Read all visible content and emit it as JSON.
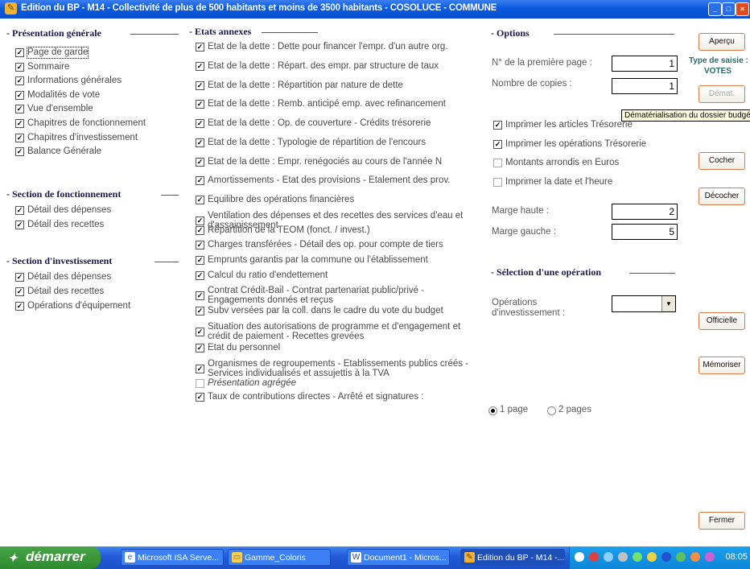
{
  "window": {
    "title": "Edition du BP - M14 - Collectivité de plus de 500 habitants et moins de 3500 habitants - COSOLUCE - COMMUNE"
  },
  "presentation": {
    "heading": "- Présentation générale",
    "items": [
      {
        "label": "Page de garde",
        "checked": true
      },
      {
        "label": "Sommaire",
        "checked": true
      },
      {
        "label": "Informations générales",
        "checked": true
      },
      {
        "label": "Modalités de vote",
        "checked": true
      },
      {
        "label": "Vue d'ensemble",
        "checked": true
      },
      {
        "label": "Chapitres de fonctionnement",
        "checked": true
      },
      {
        "label": "Chapitres d'investissement",
        "checked": true
      },
      {
        "label": "Balance Générale",
        "checked": true
      }
    ]
  },
  "fonctionnement": {
    "heading": "- Section de fonctionnement",
    "items": [
      {
        "label": "Détail des dépenses",
        "checked": true
      },
      {
        "label": "Détail des recettes",
        "checked": true
      }
    ]
  },
  "investissement": {
    "heading": "- Section d'investissement",
    "items": [
      {
        "label": "Détail des dépenses",
        "checked": true
      },
      {
        "label": "Détail des recettes",
        "checked": true
      },
      {
        "label": "Opérations d'équipement",
        "checked": true
      }
    ]
  },
  "annexes": {
    "heading": "- Etats annexes",
    "items": [
      {
        "label": "Etat de la dette : Dette pour financer l'empr. d'un autre org.",
        "checked": true
      },
      {
        "label": "Etat de la dette : Répart. des empr. par structure de taux",
        "checked": true
      },
      {
        "label": "Etat de la dette : Répartition par nature de dette",
        "checked": true
      },
      {
        "label": "Etat de la dette : Remb. anticipé emp. avec refinancement",
        "checked": true
      },
      {
        "label": "Etat de la dette : Op. de couverture - Crédits trésorerie",
        "checked": true
      },
      {
        "label": "Etat de la dette : Typologie de répartition de l'encours",
        "checked": true
      },
      {
        "label": "Etat de la dette : Empr. renégociés au cours de l'année N",
        "checked": true
      },
      {
        "label": "Amortissements - Etat des provisions - Etalement des prov.",
        "checked": true
      },
      {
        "label": "Equilibre des opérations financières",
        "checked": true
      },
      {
        "label": "Ventilation des dépenses et des recettes des services d'eau et d'assainissement",
        "checked": true
      },
      {
        "label": "Répartition de la TEOM (fonct. / invest.)",
        "checked": true
      },
      {
        "label": "Charges transférées - Détail des op. pour compte de tiers",
        "checked": true
      },
      {
        "label": "Emprunts garantis par la commune ou l'établissement",
        "checked": true
      },
      {
        "label": "Calcul du ratio d'endettement",
        "checked": true
      },
      {
        "label": "Contrat Crédit-Bail - Contrat partenariat public/privé - Engagements donnés et reçus",
        "checked": true
      },
      {
        "label": "Subv versées par la coll. dans le cadre du vote du budget",
        "checked": true
      },
      {
        "label": "Situation des autorisations de programme et d'engagement et crédit de paiement - Recettes grevées",
        "checked": true
      },
      {
        "label": "Etat du personnel",
        "checked": true
      },
      {
        "label": "Organismes de regroupements - Etablissements publics créés - Services individualisés et assujettis à la TVA",
        "checked": true
      },
      {
        "label": "Présentation agrégée",
        "checked": false
      },
      {
        "label": "Taux de contributions directes - Arrêté et signatures :",
        "checked": true
      }
    ]
  },
  "options": {
    "heading": "- Options",
    "first_page_label": "N° de la première page :",
    "first_page_value": "1",
    "copies_label": "Nombre de copies :",
    "copies_value": "1",
    "checks": [
      {
        "label": "Imprimer les articles Trésorerie",
        "checked": true
      },
      {
        "label": "Imprimer les opérations Trésorerie",
        "checked": true
      },
      {
        "label": "Montants arrondis en Euros",
        "checked": false
      },
      {
        "label": "Imprimer la date et l'heure",
        "checked": false
      }
    ],
    "marge_haute_label": "Marge haute :",
    "marge_haute_value": "2",
    "marge_gauche_label": "Marge gauche :",
    "marge_gauche_value": "5"
  },
  "selection": {
    "heading": "- Sélection d'une opération",
    "label": "Opérations d'investissement :",
    "value": ""
  },
  "pages": {
    "option1": "1 page",
    "option2": "2 pages",
    "selected": "1 page"
  },
  "type_saisie": {
    "label": "Type de saisie :",
    "value": "VOTES"
  },
  "buttons": {
    "apercu": "Aperçu",
    "demat": "Démat.",
    "cocher": "Cocher",
    "decocher": "Décocher",
    "officielle": "Officielle",
    "memoriser": "Mémoriser",
    "fermer": "Fermer"
  },
  "tooltip": "Dématérialisation du dossier budgétaire",
  "taskbar": {
    "start": "démarrer",
    "tasks": [
      "Microsoft ISA Serve...",
      "Gamme_Coloris",
      "Document1 - Micros...",
      "Edition du BP - M14 -..."
    ],
    "clock": "08:05"
  },
  "colors": {
    "titlebar": "#0a5ae0",
    "taskbar": "#245edb",
    "start": "#3a9a3a",
    "button_border": "#d87a4a"
  }
}
